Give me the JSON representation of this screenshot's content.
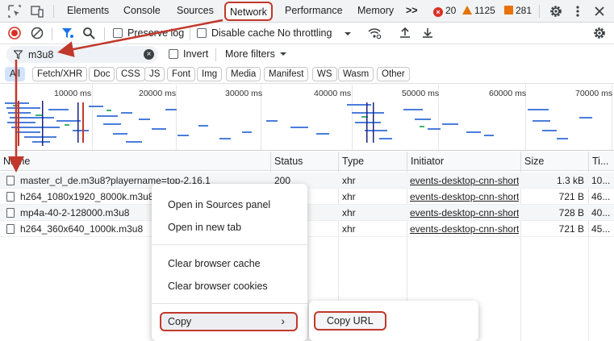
{
  "tabs": [
    "Elements",
    "Console",
    "Sources",
    "Network",
    "Performance",
    "Memory"
  ],
  "more_tabs": ">>",
  "badges": {
    "errors": "20",
    "warnings": "1125",
    "issues": "281"
  },
  "toolbar": {
    "preserve_log": "Preserve log",
    "disable_cache": "Disable cache",
    "throttling": "No throttling"
  },
  "filter": {
    "value": "m3u8",
    "invert": "Invert",
    "more_filters": "More filters"
  },
  "type_chips": [
    "All",
    "Fetch/XHR",
    "Doc",
    "CSS",
    "JS",
    "Font",
    "Img",
    "Media",
    "Manifest",
    "WS",
    "Wasm",
    "Other"
  ],
  "timeline_ticks": [
    "10000 ms",
    "20000 ms",
    "30000 ms",
    "40000 ms",
    "50000 ms",
    "60000 ms",
    "70000 ms"
  ],
  "columns": [
    "Name",
    "Status",
    "Type",
    "Initiator",
    "Size",
    "Ti..."
  ],
  "rows": [
    {
      "name": "master_cl_de.m3u8?playername=top-2.16.1",
      "status": "200",
      "type": "xhr",
      "initiator": "events-desktop-cnn-short",
      "size": "1.3 kB",
      "time": "10..."
    },
    {
      "name": "h264_1080x1920_8000k.m3u8",
      "status": "",
      "type": "xhr",
      "initiator": "events-desktop-cnn-short",
      "size": "721 B",
      "time": "46..."
    },
    {
      "name": "mp4a-40-2-128000.m3u8",
      "status": "",
      "type": "xhr",
      "initiator": "events-desktop-cnn-short",
      "size": "728 B",
      "time": "40..."
    },
    {
      "name": "h264_360x640_1000k.m3u8",
      "status": "",
      "type": "xhr",
      "initiator": "events-desktop-cnn-short",
      "size": "721 B",
      "time": "45..."
    }
  ],
  "context_menu": {
    "open_sources": "Open in Sources panel",
    "open_new_tab": "Open in new tab",
    "clear_cache": "Clear browser cache",
    "clear_cookies": "Clear browser cookies",
    "copy": "Copy",
    "copy_arrow": "›"
  },
  "submenu": {
    "copy_url": "Copy URL"
  },
  "colors": {
    "annotation": "#c0392b",
    "chip_selected": "#d2e3fc",
    "timeline_bar": "#4a7ddb"
  }
}
